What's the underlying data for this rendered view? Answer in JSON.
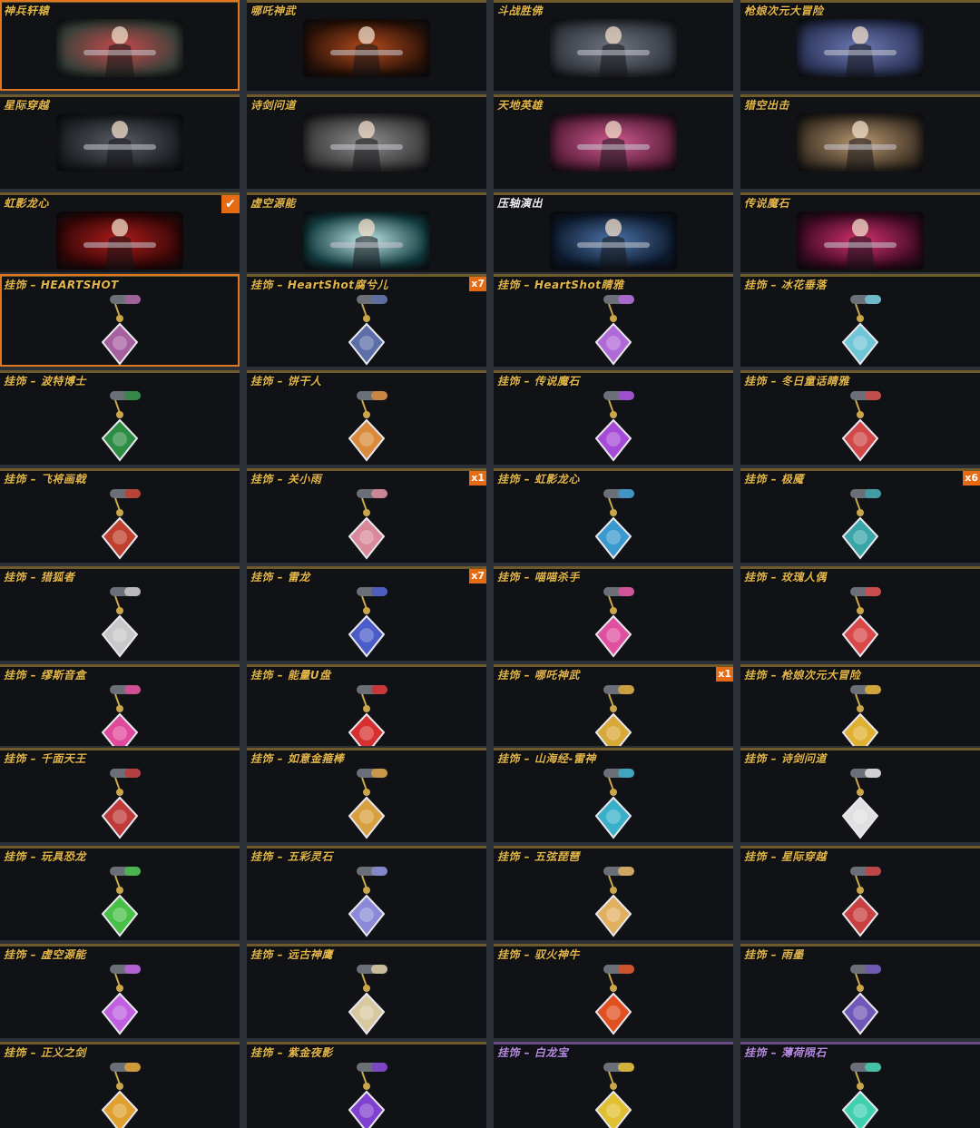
{
  "skins": [
    {
      "name": "神兵轩辕",
      "theme": [
        "#c74a4a",
        "#39413a"
      ]
    },
    {
      "name": "哪吒神武",
      "theme": [
        "#b34a1c",
        "#2a1208"
      ]
    },
    {
      "name": "斗战胜佛",
      "theme": [
        "#6f7580",
        "#33373f"
      ]
    },
    {
      "name": "枪娘次元大冒险",
      "theme": [
        "#6c79b6",
        "#2c3558"
      ]
    },
    {
      "name": "星际穿越",
      "theme": [
        "#585c64",
        "#1d1f24"
      ]
    },
    {
      "name": "诗剑问道",
      "theme": [
        "#8d8d8d",
        "#3a3a3a"
      ]
    },
    {
      "name": "天地英雄",
      "theme": [
        "#d05a8e",
        "#5b1f3b"
      ]
    },
    {
      "name": "猎空出击",
      "theme": [
        "#b89670",
        "#3f3326"
      ]
    },
    {
      "name": "虹影龙心",
      "theme": [
        "#b01c1c",
        "#330606"
      ]
    },
    {
      "name": "虚空源能",
      "theme": [
        "#bfe6e6",
        "#123c40"
      ]
    },
    {
      "name": "压轴演出",
      "theme": [
        "#4b74a8",
        "#0d1a2e"
      ]
    },
    {
      "name": "传说魔石",
      "theme": [
        "#d3306e",
        "#3c0a22"
      ]
    }
  ],
  "charms": [
    {
      "name": "挂饰 – HEARTSHOT",
      "color": "#a7609f"
    },
    {
      "name": "挂饰 – HeartShot腐兮儿",
      "color": "#5c6fa8"
    },
    {
      "name": "挂饰 – HeartShot睛雅",
      "color": "#b06ad8"
    },
    {
      "name": "挂饰 – 冰花垂落",
      "color": "#6fc6d6"
    },
    {
      "name": "挂饰 – 波特博士",
      "color": "#2e8b42"
    },
    {
      "name": "挂饰 – 饼干人",
      "color": "#d98a3a"
    },
    {
      "name": "挂饰 – 传说魔石",
      "color": "#a64bd8"
    },
    {
      "name": "挂饰 – 冬日童话睛雅",
      "color": "#d04848"
    },
    {
      "name": "挂饰 – 飞将画戟",
      "color": "#c0402e"
    },
    {
      "name": "挂饰 – 关小雨",
      "color": "#d88a9a"
    },
    {
      "name": "挂饰 – 虹影龙心",
      "color": "#3a9ad0"
    },
    {
      "name": "挂饰 – 极魇",
      "color": "#3aa6a8"
    },
    {
      "name": "挂饰 – 猎狐者",
      "color": "#c8c8c8"
    },
    {
      "name": "挂饰 – 雷龙",
      "color": "#4a5cc8"
    },
    {
      "name": "挂饰 – 喵喵杀手",
      "color": "#e050a0"
    },
    {
      "name": "挂饰 – 玫瑰人偶",
      "color": "#d84848"
    },
    {
      "name": "挂饰 – 缪斯音盒",
      "color": "#e04a9a"
    },
    {
      "name": "挂饰 – 能量U盘",
      "color": "#d83030"
    },
    {
      "name": "挂饰 – 哪吒神武",
      "color": "#d8a838"
    },
    {
      "name": "挂饰 – 枪娘次元大冒险",
      "color": "#e0b030"
    },
    {
      "name": "挂饰 – 千面天王",
      "color": "#c03a3a"
    },
    {
      "name": "挂饰 – 如意金箍棒",
      "color": "#d8a040"
    },
    {
      "name": "挂饰 – 山海经-雷神",
      "color": "#3ab0c8"
    },
    {
      "name": "挂饰 – 诗剑问道",
      "color": "#e0e0e0"
    },
    {
      "name": "挂饰 – 玩具恐龙",
      "color": "#48c048"
    },
    {
      "name": "挂饰 – 五彩灵石",
      "color": "#8a8ad8"
    },
    {
      "name": "挂饰 – 五弦琵琶",
      "color": "#e0b060"
    },
    {
      "name": "挂饰 – 星际穿越",
      "color": "#c84040"
    },
    {
      "name": "挂饰 – 虚空源能",
      "color": "#c060e0"
    },
    {
      "name": "挂饰 – 远古神鹰",
      "color": "#d8c8a0"
    },
    {
      "name": "挂饰 – 驭火神牛",
      "color": "#e05020"
    },
    {
      "name": "挂饰 – 雨墨",
      "color": "#7058b8"
    },
    {
      "name": "挂饰 – 正义之剑",
      "color": "#e0a030"
    },
    {
      "name": "挂饰 – 紫金夜影",
      "color": "#8040d0"
    },
    {
      "name": "挂饰 – 白龙宝",
      "color": "#e0c030"
    },
    {
      "name": "挂饰 – 薄荷陨石",
      "color": "#40d0b0"
    }
  ],
  "badges": {
    "skin_8": "✔",
    "charm_1": "x7",
    "charm_9": "x1",
    "charm_11": "x6",
    "charm_13": "x7",
    "charm_18": "x1"
  }
}
